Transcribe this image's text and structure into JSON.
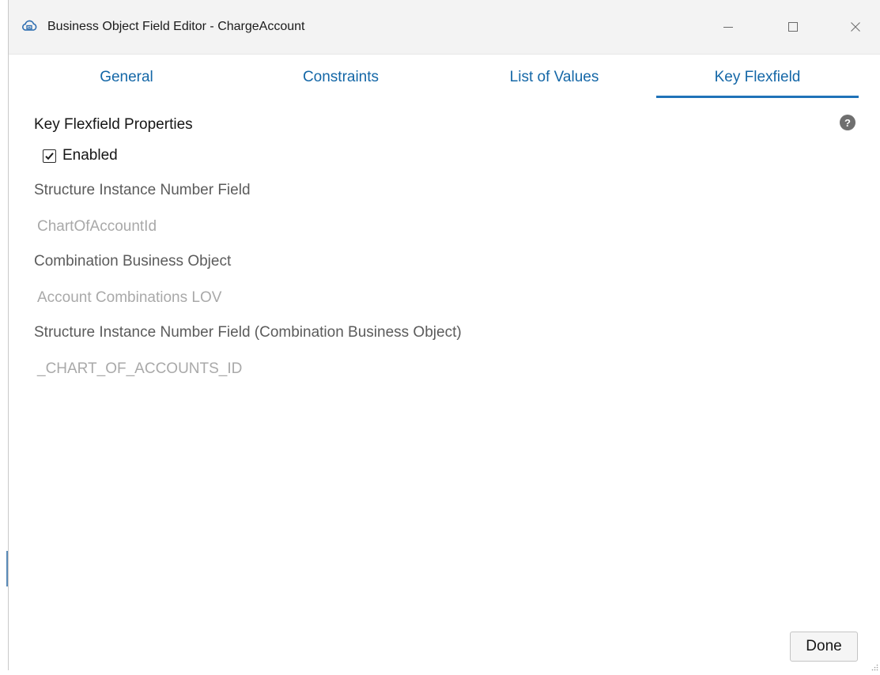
{
  "window": {
    "title": "Business Object Field Editor - ChargeAccount",
    "app_icon": "cloud-icon",
    "controls": [
      "minimize-icon",
      "maximize-icon",
      "close-icon"
    ]
  },
  "tabs": [
    {
      "label": "General",
      "active": false
    },
    {
      "label": "Constraints",
      "active": false
    },
    {
      "label": "List of Values",
      "active": false
    },
    {
      "label": "Key Flexfield",
      "active": true
    }
  ],
  "colors": {
    "tab_text": "#1467a7",
    "tab_underline": "#1f72b8",
    "label_text": "#5b5b5b",
    "value_text": "#a9a9a9"
  },
  "content": {
    "section_title": "Key Flexfield Properties",
    "help_icon": "?",
    "enabled": {
      "label": "Enabled",
      "checked": true
    },
    "fields": [
      {
        "label": "Structure Instance Number Field",
        "value": "ChartOfAccountId"
      },
      {
        "label": "Combination Business Object",
        "value": "Account Combinations LOV"
      },
      {
        "label": "Structure Instance Number Field (Combination Business Object)",
        "value": "_CHART_OF_ACCOUNTS_ID"
      }
    ]
  },
  "footer": {
    "done_label": "Done"
  }
}
